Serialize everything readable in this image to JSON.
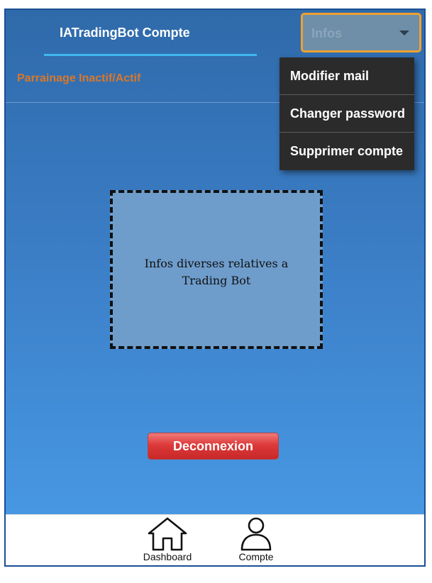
{
  "header": {
    "title": "IATradingBot Compte"
  },
  "parrainage": {
    "label": "Parrainage Inactif/Actif"
  },
  "infos_dropdown": {
    "selected": "Infos"
  },
  "menu": {
    "items": [
      {
        "label": "Modifier mail"
      },
      {
        "label": "Changer password"
      },
      {
        "label": "Supprimer compte"
      }
    ]
  },
  "info_box": {
    "line1": "Infos diverses relatives a",
    "line2": "Trading Bot"
  },
  "logout": {
    "label": "Deconnexion"
  },
  "bottom_nav": {
    "items": [
      {
        "label": "Dashboard",
        "icon": "home-icon"
      },
      {
        "label": "Compte",
        "icon": "user-icon"
      }
    ]
  },
  "colors": {
    "accent_orange": "#d9782a",
    "menu_bg": "#2b2b2b",
    "logout_red": "#dd3a3a",
    "underline_blue": "#3fb6ee"
  }
}
